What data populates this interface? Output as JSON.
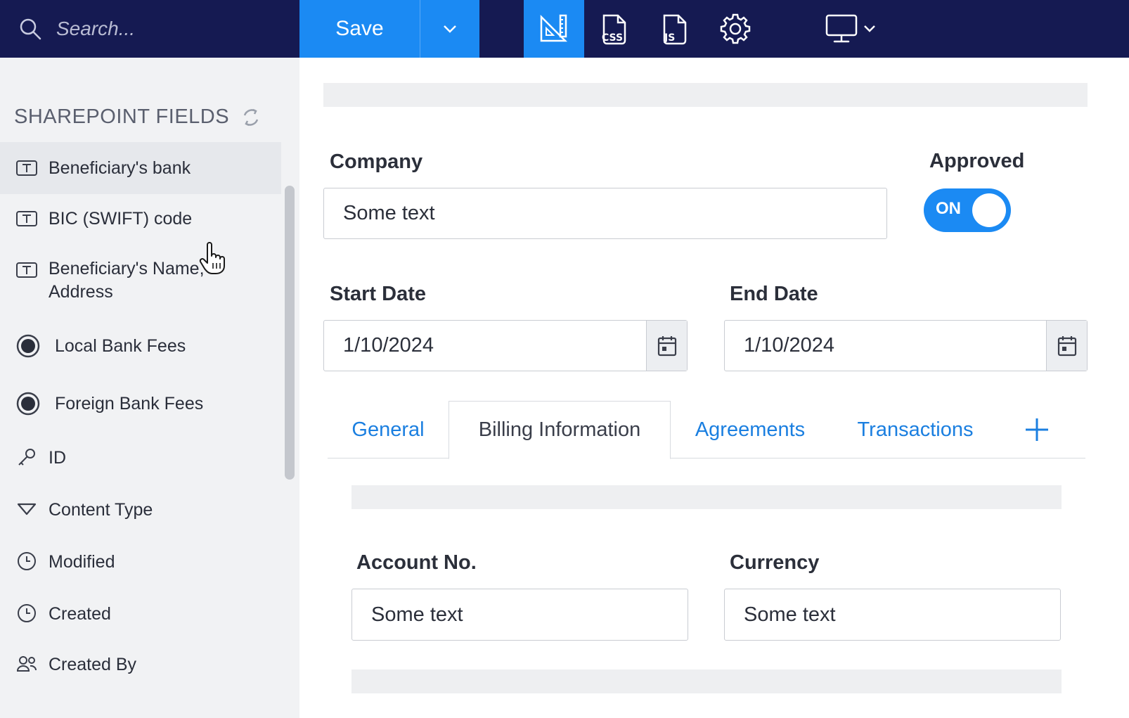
{
  "toolbar": {
    "search_placeholder": "Search...",
    "save_label": "Save",
    "tools": [
      {
        "name": "layout-ruler-icon",
        "active": true
      },
      {
        "name": "css-file-icon",
        "active": false
      },
      {
        "name": "js-file-icon",
        "active": false
      },
      {
        "name": "settings-gear-icon",
        "active": false
      }
    ],
    "device_icon": "monitor-icon"
  },
  "sidebar": {
    "title": "SHAREPOINT FIELDS",
    "fields": [
      {
        "label": "Beneficiary's bank",
        "icon": "text-field-icon"
      },
      {
        "label": "BIC (SWIFT) code",
        "icon": "text-field-icon"
      },
      {
        "label_line1": "Beneficiary's Name,",
        "label_line2": "Address",
        "icon": "text-field-icon"
      },
      {
        "label": "Local Bank Fees",
        "icon": "radio-icon"
      },
      {
        "label": "Foreign Bank Fees",
        "icon": "radio-icon"
      },
      {
        "label": "ID",
        "icon": "key-icon"
      },
      {
        "label": "Content Type",
        "icon": "triangle-icon"
      },
      {
        "label": "Modified",
        "icon": "clock-icon"
      },
      {
        "label": "Created",
        "icon": "clock-icon"
      },
      {
        "label": "Created By",
        "icon": "users-icon"
      }
    ]
  },
  "form": {
    "company_label": "Company",
    "company_value": "Some text",
    "approved_label": "Approved",
    "approved_toggle_text": "ON",
    "start_date_label": "Start Date",
    "start_date_value": "1/10/2024",
    "end_date_label": "End Date",
    "end_date_value": "1/10/2024",
    "tabs": [
      {
        "label": "General",
        "active": false
      },
      {
        "label": "Billing Information",
        "active": true
      },
      {
        "label": "Agreements",
        "active": false
      },
      {
        "label": "Transactions",
        "active": false
      }
    ],
    "account_label": "Account No.",
    "account_value": "Some text",
    "currency_label": "Currency",
    "currency_value": "Some text"
  },
  "colors": {
    "topbar": "#151a52",
    "accent": "#1b8af3",
    "sidebar_bg": "#f1f2f4",
    "tab_link": "#1b7fe0"
  }
}
